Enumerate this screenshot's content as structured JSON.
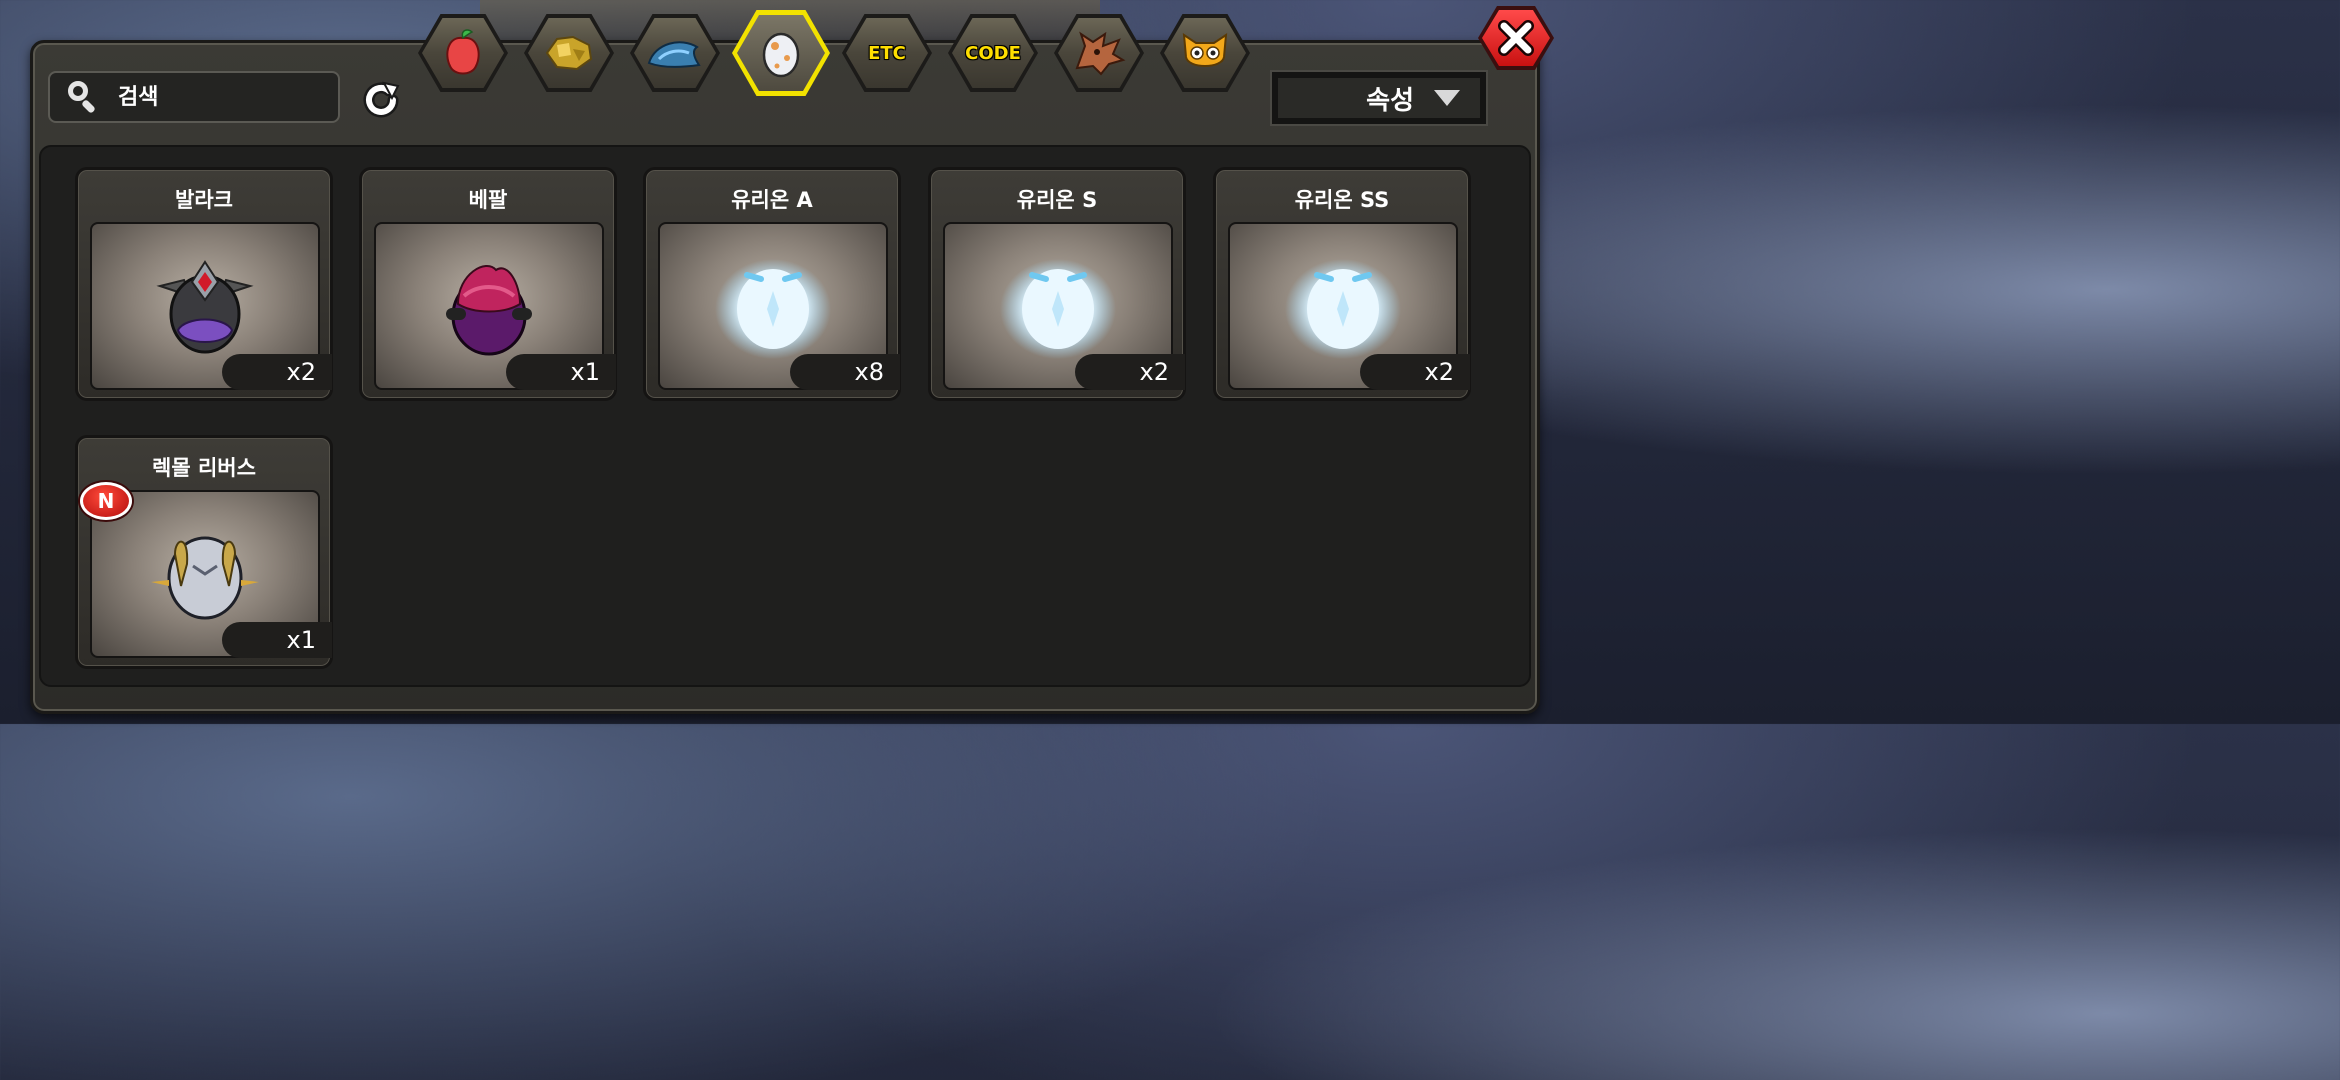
{
  "search": {
    "placeholder": "검색"
  },
  "sort": {
    "label": "속성"
  },
  "tabs": [
    {
      "name": "fruit-tab-icon",
      "text": ""
    },
    {
      "name": "ore-tab-icon",
      "text": ""
    },
    {
      "name": "fish-tab-icon",
      "text": ""
    },
    {
      "name": "egg-tab-icon",
      "text": "",
      "active": true
    },
    {
      "name": "etc-tab",
      "text": "ETC"
    },
    {
      "name": "code-tab",
      "text": "CODE"
    },
    {
      "name": "dragon-tab-icon",
      "text": ""
    },
    {
      "name": "owl-tab-icon",
      "text": ""
    }
  ],
  "items": [
    {
      "name": "발라크",
      "count": "x2"
    },
    {
      "name": "베팔",
      "count": "x1"
    },
    {
      "name": "유리온 A",
      "count": "x8"
    },
    {
      "name": "유리온 S",
      "count": "x2"
    },
    {
      "name": "유리온 SS",
      "count": "x2"
    },
    {
      "name": "렉몰 리버스",
      "count": "x1",
      "badge": "N"
    }
  ],
  "colors": {
    "active_tab": "#f2e200",
    "panel": "#2c2b28",
    "close": "#c91111"
  }
}
